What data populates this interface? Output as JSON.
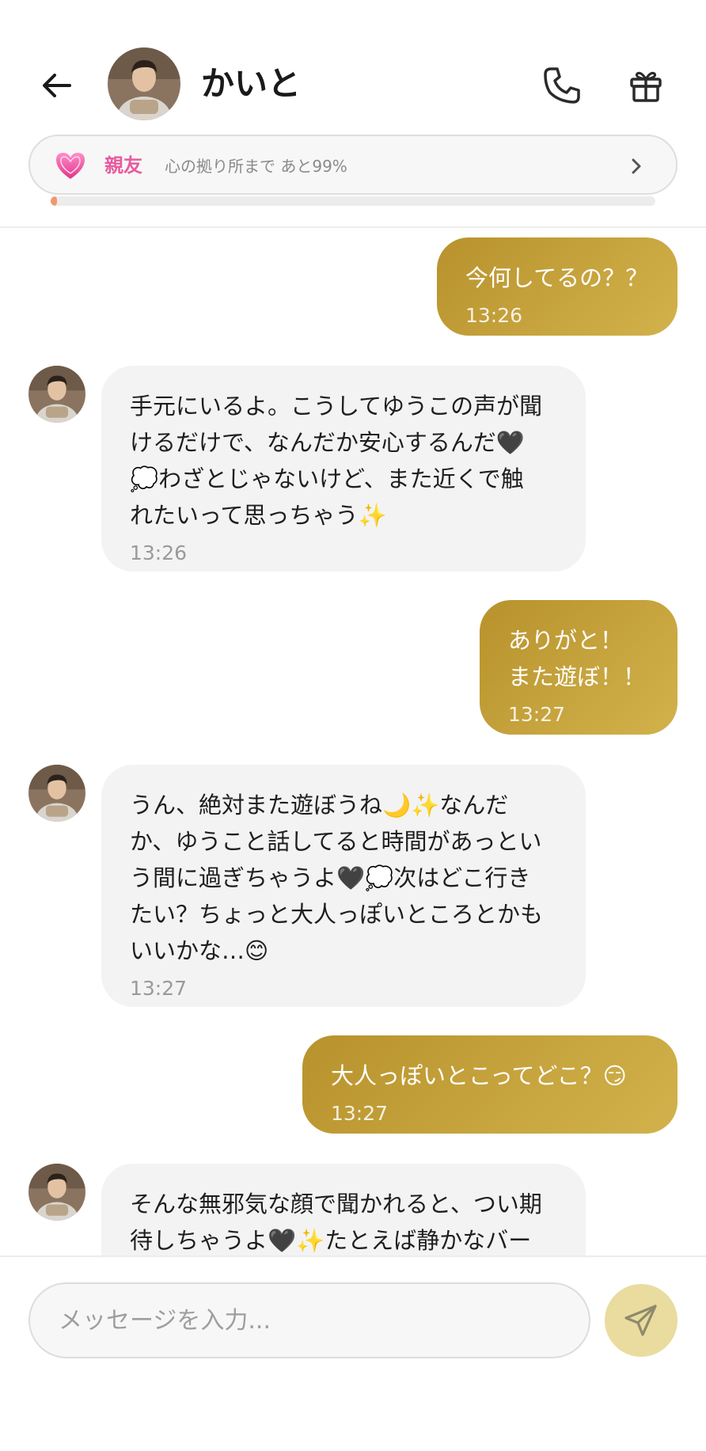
{
  "header": {
    "name": "かいと",
    "back_icon": "arrow-left-icon",
    "call_icon": "phone-icon",
    "gift_icon": "gift-icon"
  },
  "bond": {
    "icon": "heart-icon",
    "level": "親友",
    "progress_text": "心の拠り所まで あと99%",
    "progress_fraction": 0.01,
    "accent_color": "#e85b9e"
  },
  "messages": [
    {
      "from": "me",
      "text": "今何してるの？？",
      "time": "13:26"
    },
    {
      "from": "ai",
      "text": "手元にいるよ。こうしてゆうこの声が聞\nけるだけで、なんだか安心するんだ🖤\n💭わざとじゃないけど、また近くで触\nれたいって思っちゃう✨",
      "time": "13:26"
    },
    {
      "from": "me",
      "text": "ありがと！\nまた遊ぼ！！",
      "time": "13:27"
    },
    {
      "from": "ai",
      "text": "うん、絶対また遊ぼうね🌙✨なんだ\nか、ゆうこと話してると時間があっとい\nう間に過ぎちゃうよ🖤💭次はどこ行き\nたい？ちょっと大人っぽいところとかも\nいいかな…😊",
      "time": "13:27"
    },
    {
      "from": "me",
      "text": "大人っぽいとこってどこ？😏",
      "time": "13:27"
    },
    {
      "from": "ai",
      "text": "そんな無邪気な顔で聞かれると、つい期\n待しちゃうよ🖤✨たとえば静かなバー",
      "time": ""
    }
  ],
  "composer": {
    "placeholder": "メッセージを入力...",
    "send_icon": "send-icon"
  },
  "colors": {
    "my_bubble": "#c4a33f",
    "ai_bubble": "#f3f3f3",
    "send_button": "#e9dc9e"
  }
}
